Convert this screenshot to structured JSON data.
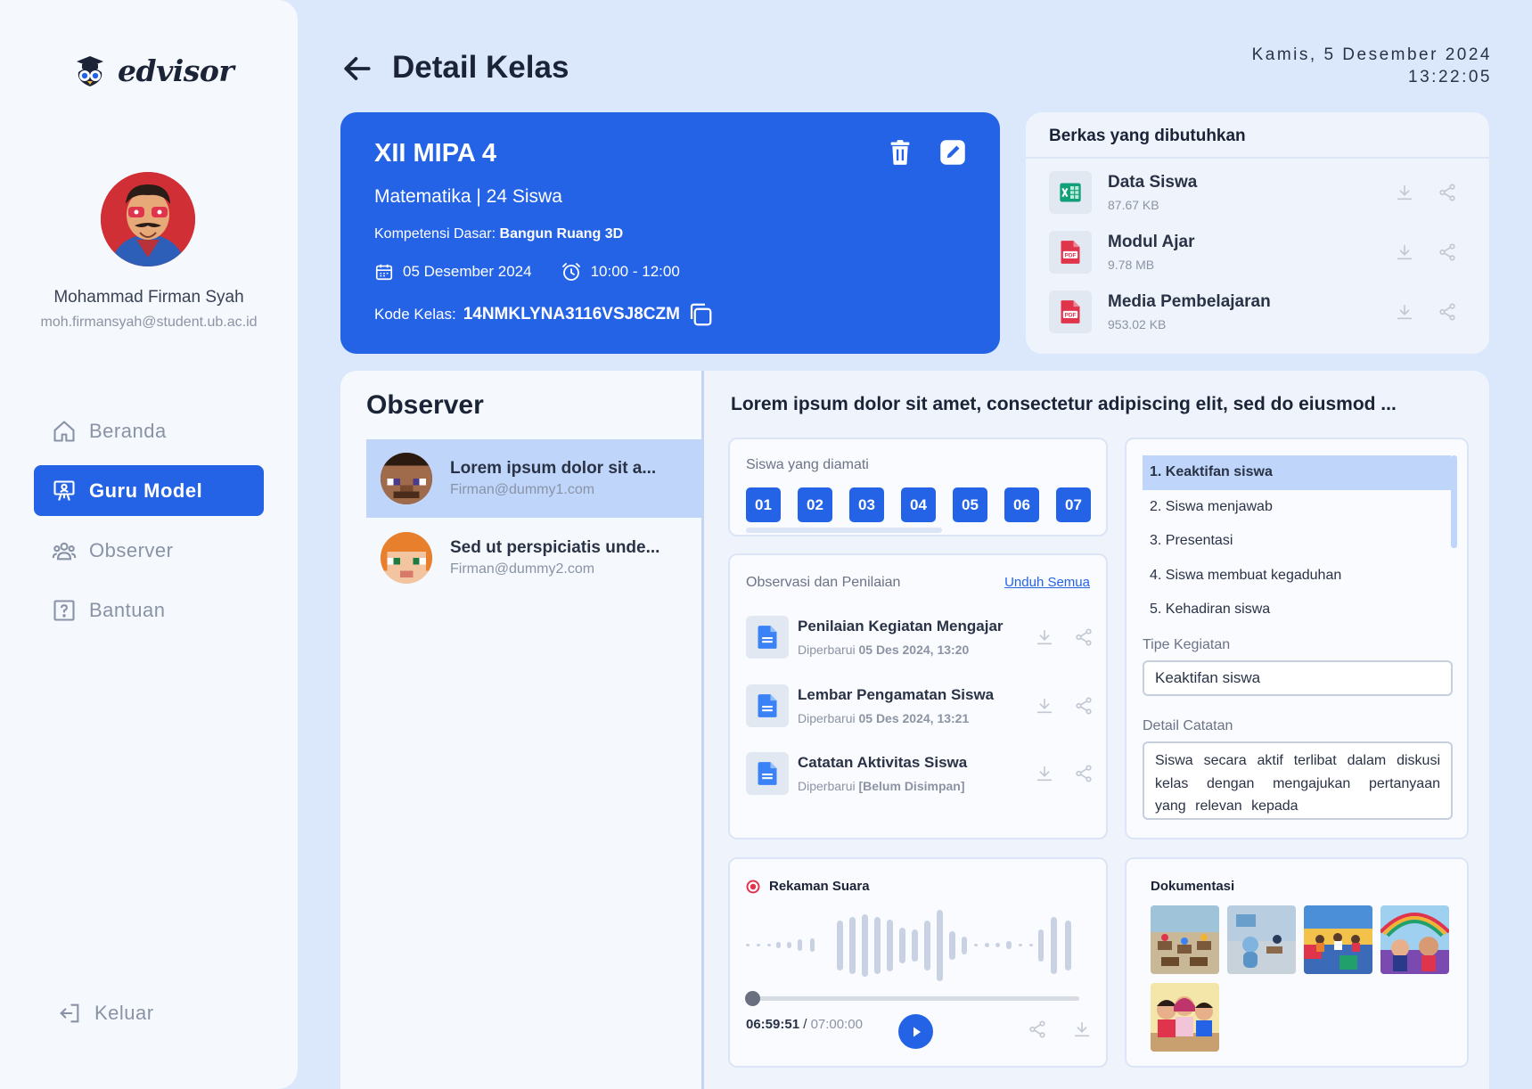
{
  "app": {
    "brand": "edvisor"
  },
  "user": {
    "name": "Mohammad Firman Syah",
    "email": "moh.firmansyah@student.ub.ac.id"
  },
  "nav": {
    "items": [
      {
        "label": "Beranda",
        "icon": "home-icon",
        "active": false
      },
      {
        "label": "Guru Model",
        "icon": "presentation-icon",
        "active": true
      },
      {
        "label": "Observer",
        "icon": "users-icon",
        "active": false
      },
      {
        "label": "Bantuan",
        "icon": "help-icon",
        "active": false
      }
    ],
    "logout": "Keluar"
  },
  "header": {
    "title": "Detail Kelas",
    "date": "Kamis, 5 Desember 2024",
    "time": "13:22:05"
  },
  "class_info": {
    "name": "XII MIPA 4",
    "subject": "Matematika | 24 Siswa",
    "kd_label": "Kompetensi Dasar:",
    "kd_value": "Bangun Ruang 3D",
    "date": "05 Desember 2024",
    "time": "10:00 - 12:00",
    "code_label": "Kode Kelas:",
    "code": "14NMKLYNA3116VSJ8CZM"
  },
  "files": {
    "title": "Berkas yang dibutuhkan",
    "items": [
      {
        "name": "Data Siswa",
        "size": "87.67 KB",
        "icon": "excel-icon"
      },
      {
        "name": "Modul Ajar",
        "size": "9.78 MB",
        "icon": "pdf-icon"
      },
      {
        "name": "Media Pembelajaran",
        "size": "953.02 KB",
        "icon": "pdf-icon"
      }
    ]
  },
  "observer": {
    "title": "Observer",
    "items": [
      {
        "name": "Lorem ipsum dolor sit a...",
        "email": "Firman@dummy1.com",
        "active": true
      },
      {
        "name": "Sed ut perspiciatis unde...",
        "email": "Firman@dummy2.com",
        "active": false
      }
    ]
  },
  "detail": {
    "title": "Lorem ipsum dolor sit amet, consectetur adipiscing elit, sed do eiusmod ...",
    "siswa_label": "Siswa yang diamati",
    "siswa": [
      "01",
      "02",
      "03",
      "04",
      "05",
      "06",
      "07"
    ],
    "obsv_label": "Observasi dan Penilaian",
    "download_all": "Unduh Semua",
    "docs": [
      {
        "name": "Penilaian Kegiatan Mengajar",
        "meta_prefix": "Diperbarui",
        "meta_value": "05 Des 2024, 13:20"
      },
      {
        "name": "Lembar Pengamatan Siswa",
        "meta_prefix": "Diperbarui",
        "meta_value": "05 Des 2024, 13:21"
      },
      {
        "name": "Catatan Aktivitas Siswa",
        "meta_prefix": "Diperbarui",
        "meta_value": "[Belum Disimpan]"
      }
    ],
    "aspects": [
      "1. Keaktifan siswa",
      "2. Siswa menjawab",
      "3. Presentasi",
      "4. Siswa membuat kegaduhan",
      "5. Kehadiran siswa"
    ],
    "aspect_active": 0,
    "tipe_label": "Tipe Kegiatan",
    "tipe_value": "Keaktifan siswa",
    "catatan_label": "Detail Catatan",
    "catatan_value": "Siswa secara aktif terlibat dalam diskusi kelas dengan mengajukan pertanyaan yang relevan kepada",
    "audio_title": "Rekaman Suara",
    "audio_current": "06:59:51",
    "audio_total": "07:00:00",
    "audio_progress": 0,
    "doc_title": "Dokumentasi",
    "photos": [
      "classroom-photo",
      "classroom-photo",
      "classroom-photo",
      "classroom-photo",
      "kids-photo"
    ]
  },
  "colors": {
    "accent": "#2563e6",
    "background": "#dbe8fb",
    "record": "#e0344c"
  }
}
